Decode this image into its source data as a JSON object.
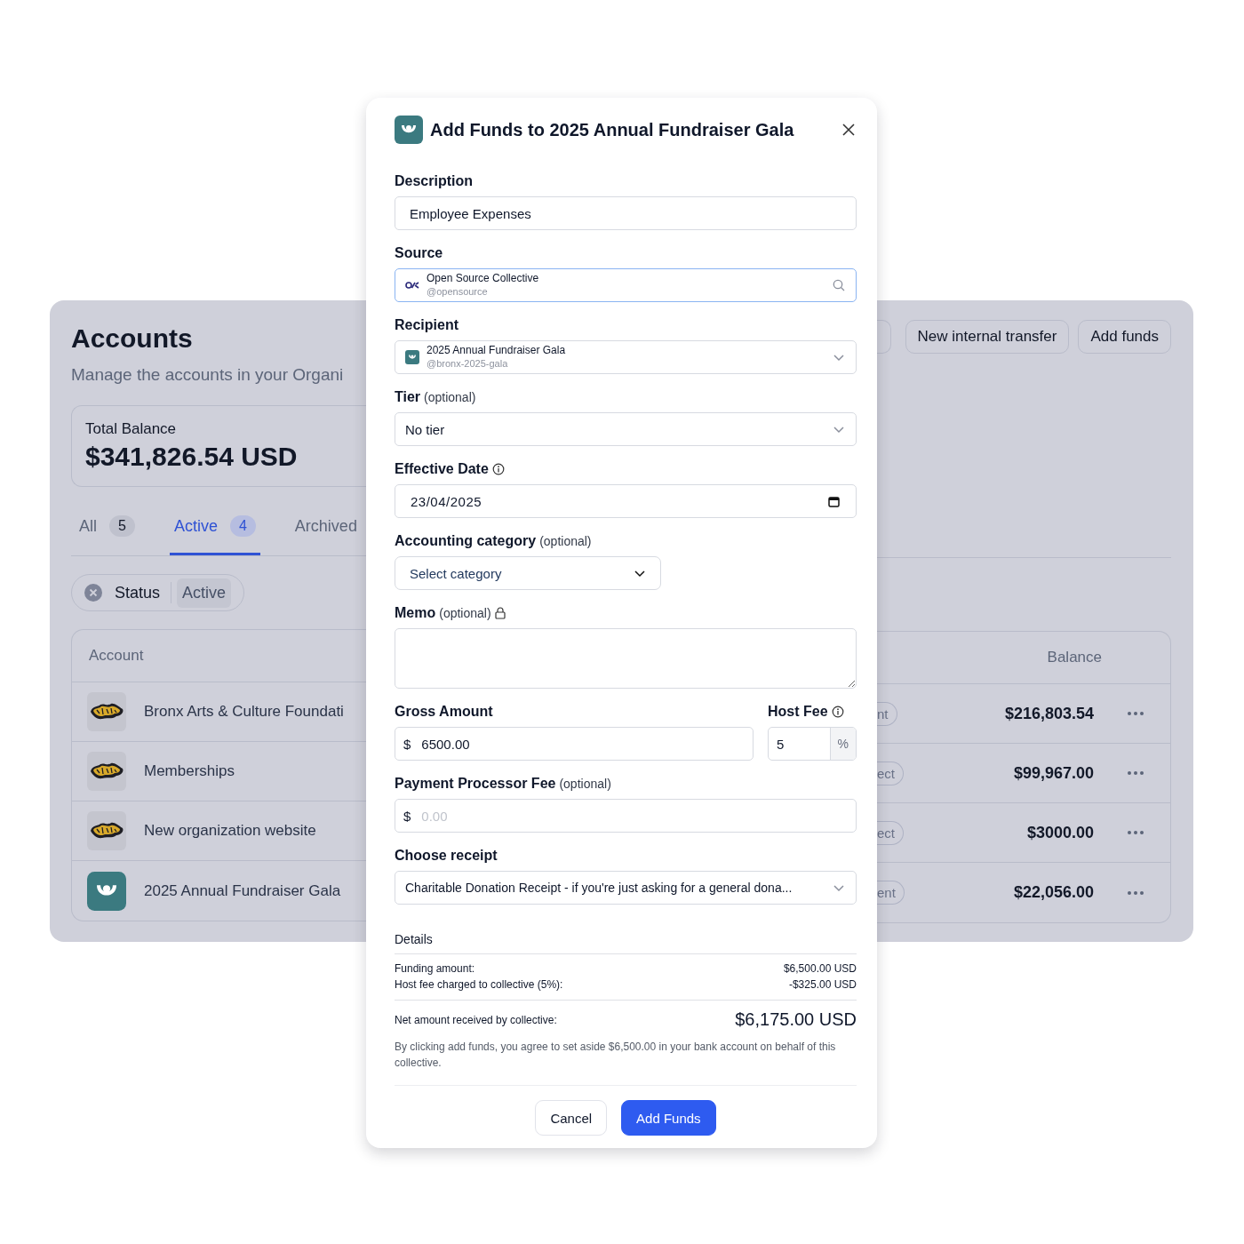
{
  "page": {
    "title": "Accounts",
    "subtitle": "Manage the accounts in your Organi",
    "actions": [
      "New internal transfer",
      "Add funds"
    ],
    "total_balance": {
      "label": "Total Balance",
      "value": "$341,826.54 USD"
    },
    "tabs": [
      {
        "label": "All",
        "count": "5",
        "selected": false
      },
      {
        "label": "Active",
        "count": "4",
        "selected": true
      },
      {
        "label": "Archived",
        "selected": false
      }
    ],
    "filter": {
      "label": "Status",
      "value": "Active"
    },
    "table": {
      "columns": [
        "Account",
        "Balance"
      ],
      "rows": [
        {
          "kind": "graffiti",
          "name": "Bronx Arts & Culture Foundati",
          "type": "nt",
          "balance": "$216,803.54"
        },
        {
          "kind": "graffiti",
          "name": "Memberships",
          "type": "ect",
          "balance": "$99,967.00"
        },
        {
          "kind": "graffiti",
          "name": "New organization website",
          "type": "ect",
          "balance": "$3000.00"
        },
        {
          "kind": "gala",
          "name": "2025 Annual Fundraiser Gala",
          "type": "ent",
          "balance": "$22,056.00"
        }
      ]
    }
  },
  "dialog": {
    "title": "Add Funds to 2025 Annual Fundraiser Gala",
    "description": {
      "label": "Description",
      "value": "Employee Expenses"
    },
    "source": {
      "label": "Source",
      "name": "Open Source Collective",
      "handle": "@opensource",
      "focused": true
    },
    "recipient": {
      "label": "Recipient",
      "name": "2025 Annual Fundraiser Gala",
      "handle": "@bronx-2025-gala",
      "focused": false
    },
    "tier": {
      "label": "Tier",
      "hint": "(optional)",
      "value": "No tier"
    },
    "effective_date": {
      "label": "Effective Date",
      "value": "23/04/2025"
    },
    "accounting_category": {
      "label": "Accounting category",
      "hint": "(optional)",
      "placeholder": "Select category"
    },
    "memo": {
      "label": "Memo",
      "hint": "(optional)"
    },
    "gross_amount": {
      "label": "Gross Amount",
      "currency": "$",
      "value": "6500.00"
    },
    "host_fee": {
      "label": "Host Fee",
      "value": "5",
      "unit": "%"
    },
    "processor_fee": {
      "label": "Payment Processor Fee",
      "hint": "(optional)",
      "currency": "$",
      "placeholder": "0.00"
    },
    "receipt": {
      "label": "Choose receipt",
      "value": "Charitable Donation Receipt - if you're just asking for a general dona..."
    },
    "details": {
      "title": "Details",
      "rows": [
        {
          "label": "Funding amount:",
          "value": "$6,500.00 USD"
        },
        {
          "label": "Host fee charged to collective (5%):",
          "value": "-$325.00 USD"
        }
      ],
      "net": {
        "label": "Net amount received by collective:",
        "value": "$6,175.00 USD"
      },
      "note": "By clicking add funds, you agree to set aside $6,500.00 in your bank account on behalf of this collective."
    },
    "buttons": [
      {
        "label": "Cancel",
        "kind": "secondary"
      },
      {
        "label": "Add Funds",
        "kind": "primary"
      }
    ]
  }
}
